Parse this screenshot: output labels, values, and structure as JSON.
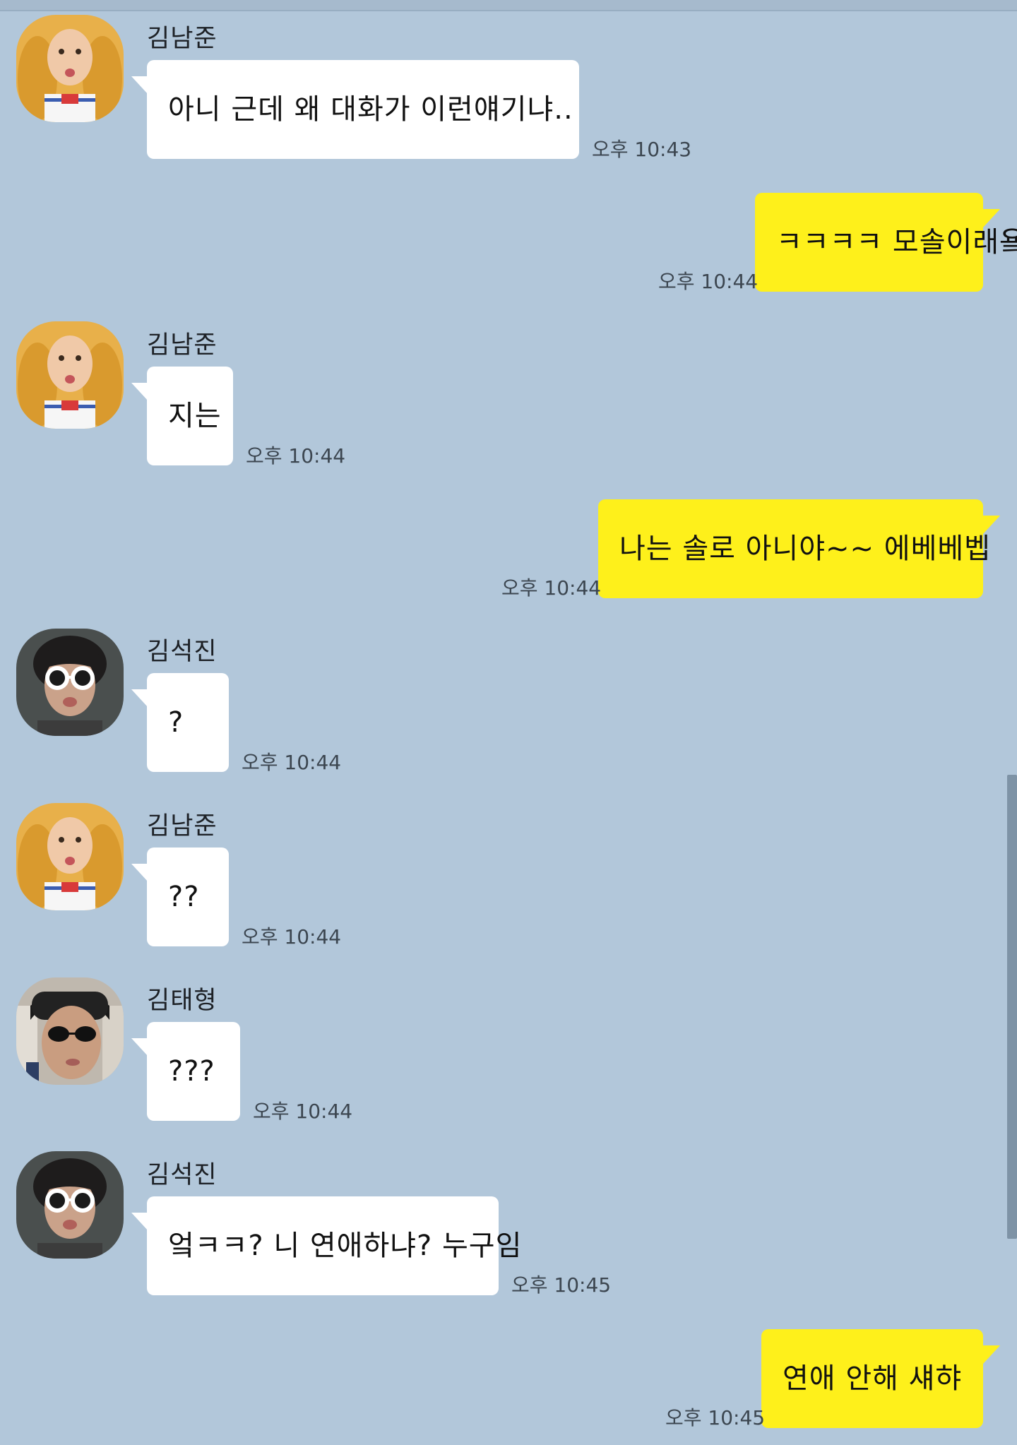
{
  "colors": {
    "background": "#b2c7da",
    "incoming_bubble": "#ffffff",
    "outgoing_bubble": "#fef01b",
    "time_text": "#3c4650"
  },
  "messages": [
    {
      "sender": "김남준",
      "avatar": "namjoon-avatar",
      "text": "아니 근데 왜 대화가 이런얘기냐..",
      "time": "오후 10:43",
      "outgoing": false
    },
    {
      "text": "ㅋㅋㅋㅋ 모솔이래욬",
      "time": "오후 10:44",
      "outgoing": true
    },
    {
      "sender": "김남준",
      "avatar": "namjoon-avatar",
      "text": "지는",
      "time": "오후 10:44",
      "outgoing": false
    },
    {
      "text": "나는 솔로 아니야~~ 에베베벱",
      "time": "오후 10:44",
      "outgoing": true
    },
    {
      "sender": "김석진",
      "avatar": "seokjin-avatar",
      "text": "?",
      "time": "오후 10:44",
      "outgoing": false
    },
    {
      "sender": "김남준",
      "avatar": "namjoon-avatar",
      "text": "??",
      "time": "오후 10:44",
      "outgoing": false
    },
    {
      "sender": "김태형",
      "avatar": "taehyung-avatar",
      "text": "???",
      "time": "오후 10:44",
      "outgoing": false
    },
    {
      "sender": "김석진",
      "avatar": "seokjin-avatar",
      "text": "엌ㅋㅋ? 니 연애하냐? 누구임",
      "time": "오후 10:45",
      "outgoing": false
    },
    {
      "text": "연애 안해 섀햐",
      "time": "오후 10:45",
      "outgoing": true
    }
  ]
}
